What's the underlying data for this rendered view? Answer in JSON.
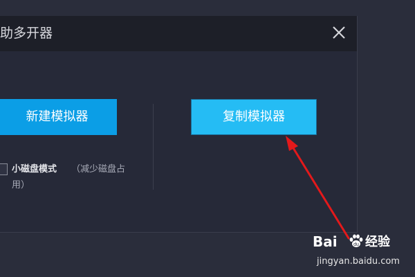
{
  "dialog": {
    "title": "助多开器",
    "new_button_label": "新建模拟器",
    "copy_button_label": "复制模拟器",
    "small_disk_mode": {
      "label": "小磁盘模式",
      "hint_line1": "（减少磁盘占",
      "hint_line2": "用）",
      "checked": false
    },
    "icons": {
      "close": "close-icon",
      "annotation": "red-arrow-icon",
      "watermark": "baidu-paw-icon"
    }
  },
  "watermark": {
    "brand_left": "Bai",
    "brand_right": "经验",
    "url": "jingyan.baidu.com"
  },
  "colors": {
    "titlebar": "#1d1f28",
    "panel": "#262938",
    "new_button": "#0b9ee6",
    "copy_button": "#25bcf4",
    "arrow": "#e3191b"
  }
}
